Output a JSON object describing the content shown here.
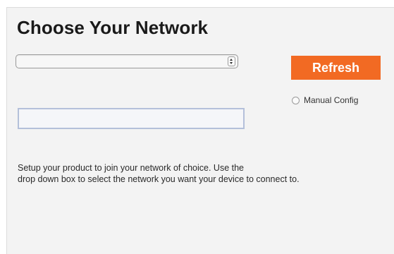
{
  "page": {
    "title": "Choose Your Network"
  },
  "network_select": {
    "selected_value": ""
  },
  "refresh_button": {
    "label": "Refresh",
    "color": "#f26a23"
  },
  "manual_config": {
    "label": "Manual Config",
    "checked": false
  },
  "network_input": {
    "value": ""
  },
  "description": {
    "line1": "Setup your product to join your network of choice. Use the",
    "line2": "drop down box to select the network you want your device to connect to."
  }
}
